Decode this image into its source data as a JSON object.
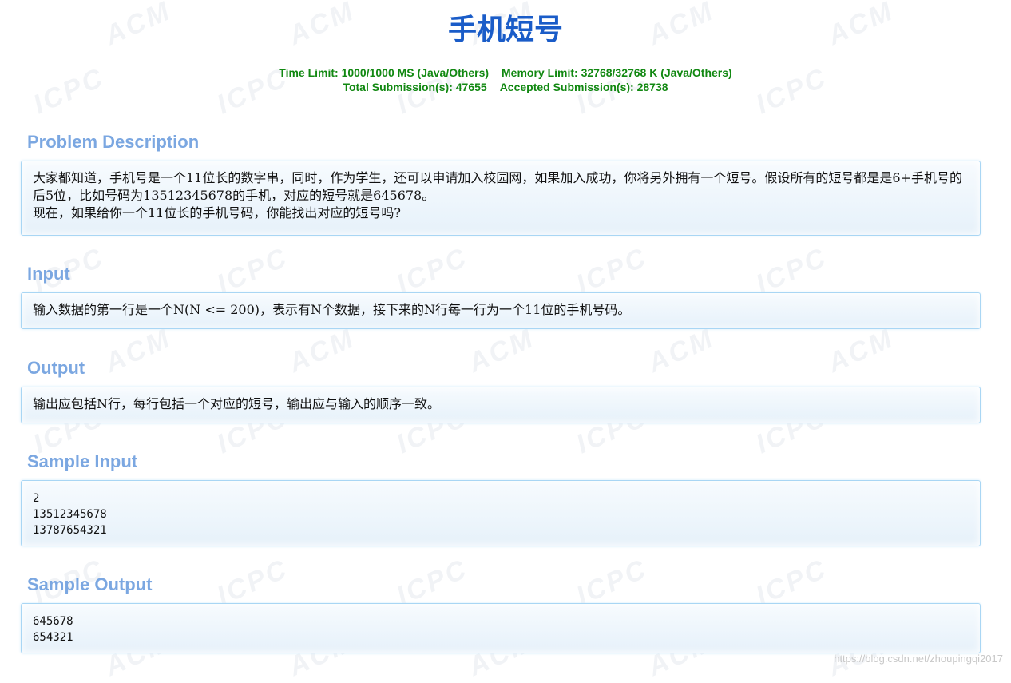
{
  "title": "手机短号",
  "limits": {
    "line1_time": "Time Limit: 1000/1000 MS (Java/Others)",
    "line1_memory": "Memory Limit: 32768/32768 K (Java/Others)",
    "line2_total": "Total Submission(s): 47655",
    "line2_accepted": "Accepted Submission(s): 28738"
  },
  "sections": {
    "description": {
      "title": "Problem Description",
      "line1": "大家都知道，手机号是一个11位长的数字串，同时，作为学生，还可以申请加入校园网，如果加入成功，你将另外拥有一个短号。假设所有的短号都是是6+手机号的后5位，比如号码为13512345678的手机，对应的短号就是645678。",
      "line2": "现在，如果给你一个11位长的手机号码，你能找出对应的短号吗?"
    },
    "input": {
      "title": "Input",
      "text": "输入数据的第一行是一个N(N <= 200)，表示有N个数据，接下来的N行每一行为一个11位的手机号码。"
    },
    "output": {
      "title": "Output",
      "text": "输出应包括N行，每行包括一个对应的短号，输出应与输入的顺序一致。"
    },
    "sample_input": {
      "title": "Sample Input",
      "text": "2\n13512345678\n13787654321"
    },
    "sample_output": {
      "title": "Sample Output",
      "text": "645678\n654321"
    }
  },
  "watermark": {
    "word_a": "ACM",
    "word_b": "ICPC",
    "color": "#f1f3f6"
  },
  "footer": {
    "url": "https://blog.csdn.net/zhoupingqi2017"
  }
}
